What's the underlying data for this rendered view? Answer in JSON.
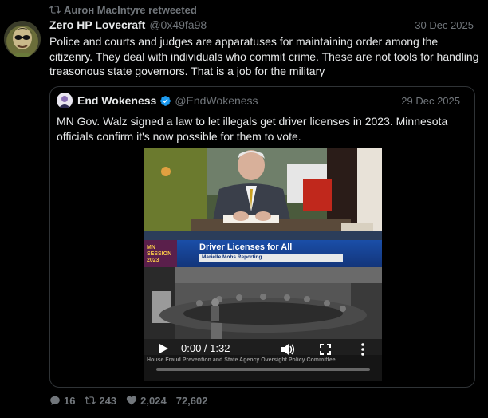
{
  "retweet": {
    "text": "Aurон MacIntyre retweeted"
  },
  "tweet": {
    "name": "Zero HP Lovecraft",
    "handle": "@0x49fa98",
    "date": "30 Dec 2025",
    "text": "Police and courts and judges are apparatuses for maintaining order among the citizenry. They deal with individuals who commit crime. These are not tools for handling treasonous state governors. That is a job for the military"
  },
  "quote": {
    "name": "End Wokeness",
    "handle": "@EndWokeness",
    "date": "29 Dec 2025",
    "text": "MN Gov. Walz signed a law to let illegals get driver licenses in 2023. Minnesota officials confirm it's now possible for them to vote.",
    "video": {
      "logo_line1": "MN",
      "logo_line2": "SESSION",
      "logo_line3": "2023",
      "banner_title": "Driver Licenses for All",
      "banner_sub": "Marielle Mohs Reporting",
      "caption_strip": "House Fraud Prevention and State Agency Oversight Policy Committee",
      "time": "0:00 / 1:32",
      "progress": 0
    }
  },
  "stats": {
    "replies": "16",
    "retweets": "243",
    "likes": "2,024",
    "views": "72,602"
  },
  "icons": {
    "retweet": "retweet-icon",
    "verified": "verified-badge-icon",
    "reply": "reply-icon",
    "like": "heart-icon",
    "play": "play-icon",
    "volume": "volume-icon",
    "fullscreen": "fullscreen-icon",
    "more": "more-icon"
  },
  "colors": {
    "accent": "#1d9bf0",
    "muted": "#71767b",
    "text": "#e7e9ea"
  }
}
